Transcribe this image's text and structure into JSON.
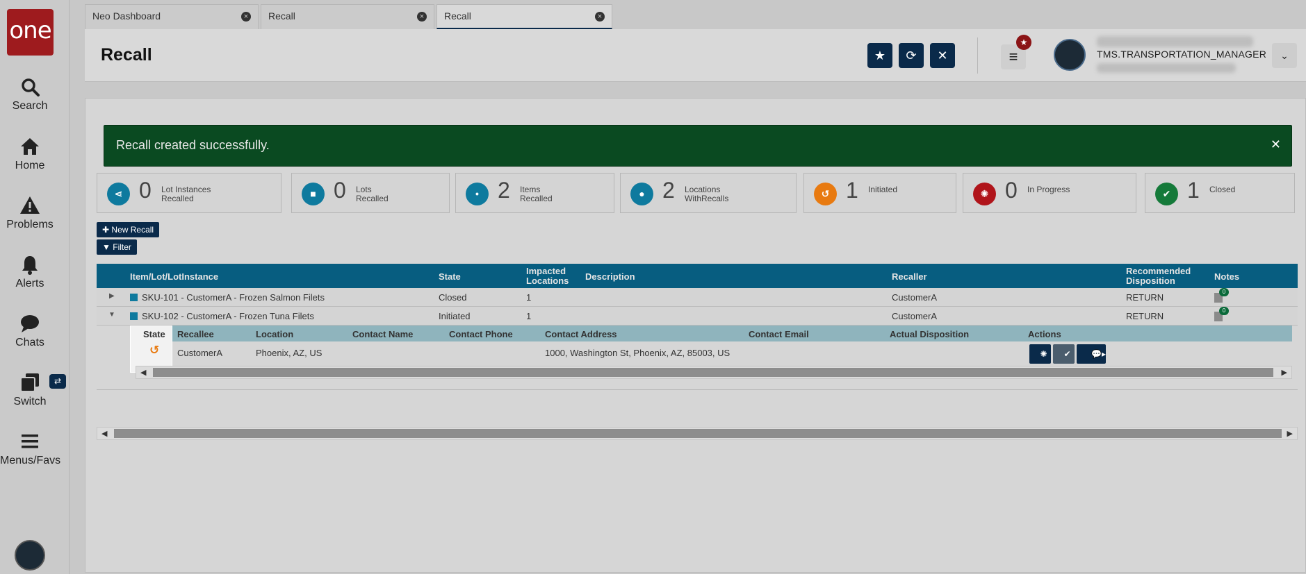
{
  "sidebar": {
    "logo": "one",
    "items": [
      {
        "label": "Search",
        "icon": "search-icon"
      },
      {
        "label": "Home",
        "icon": "home-icon"
      },
      {
        "label": "Problems",
        "icon": "warning-icon"
      },
      {
        "label": "Alerts",
        "icon": "bell-icon"
      },
      {
        "label": "Chats",
        "icon": "chat-icon"
      },
      {
        "label": "Switch",
        "icon": "switch-icon"
      },
      {
        "label": "Menus/Favs",
        "icon": "hamburger-icon"
      }
    ]
  },
  "tabs": [
    {
      "label": "Neo Dashboard"
    },
    {
      "label": "Recall"
    },
    {
      "label": "Recall"
    }
  ],
  "header": {
    "title": "Recall",
    "user_name": "TMS.TRANSPORTATION_MANAGER"
  },
  "alert": {
    "message": "Recall created successfully.",
    "color": "#0a4a21"
  },
  "stats": [
    {
      "value": "0",
      "line1": "Lot Instances",
      "line2": "Recalled",
      "color": "#0e7a9e"
    },
    {
      "value": "0",
      "line1": "Lots",
      "line2": "Recalled",
      "color": "#0e7a9e"
    },
    {
      "value": "2",
      "line1": "Items",
      "line2": "Recalled",
      "color": "#0e7a9e"
    },
    {
      "value": "2",
      "line1": "Locations",
      "line2": "WithRecalls",
      "color": "#0e7a9e"
    },
    {
      "value": "1",
      "line1": "Initiated",
      "line2": "",
      "color": "#e87a10"
    },
    {
      "value": "0",
      "line1": "In Progress",
      "line2": "",
      "color": "#b0141a"
    },
    {
      "value": "1",
      "line1": "Closed",
      "line2": "",
      "color": "#157a3a"
    }
  ],
  "toolbar": {
    "new_recall": "New Recall",
    "filter": "Filter"
  },
  "grid": {
    "columns": {
      "item": "Item/Lot/LotInstance",
      "state": "State",
      "impacted_1": "Impacted",
      "impacted_2": "Locations",
      "description": "Description",
      "recaller": "Recaller",
      "disposition_1": "Recommended",
      "disposition_2": "Disposition",
      "notes": "Notes"
    },
    "rows": [
      {
        "item": "SKU-101 - CustomerA - Frozen Salmon Filets",
        "state": "Closed",
        "impacted": "1",
        "description": "",
        "recaller": "CustomerA",
        "disposition": "RETURN",
        "notes": "0"
      },
      {
        "item": "SKU-102 - CustomerA - Frozen Tuna Filets",
        "state": "Initiated",
        "impacted": "1",
        "description": "",
        "recaller": "CustomerA",
        "disposition": "RETURN",
        "notes": "0"
      }
    ],
    "sub": {
      "columns": {
        "state": "State",
        "recallee": "Recallee",
        "location": "Location",
        "contact_name": "Contact Name",
        "contact_phone": "Contact Phone",
        "contact_address": "Contact Address",
        "contact_email": "Contact Email",
        "actual_disposition": "Actual Disposition",
        "actions": "Actions"
      },
      "row": {
        "recallee": "CustomerA",
        "location": "Phoenix, AZ, US",
        "contact_name": "",
        "contact_phone": "",
        "contact_address": "1000, Washington St, Phoenix, AZ, 85003, US",
        "contact_email": "",
        "actual_disposition": ""
      }
    }
  }
}
